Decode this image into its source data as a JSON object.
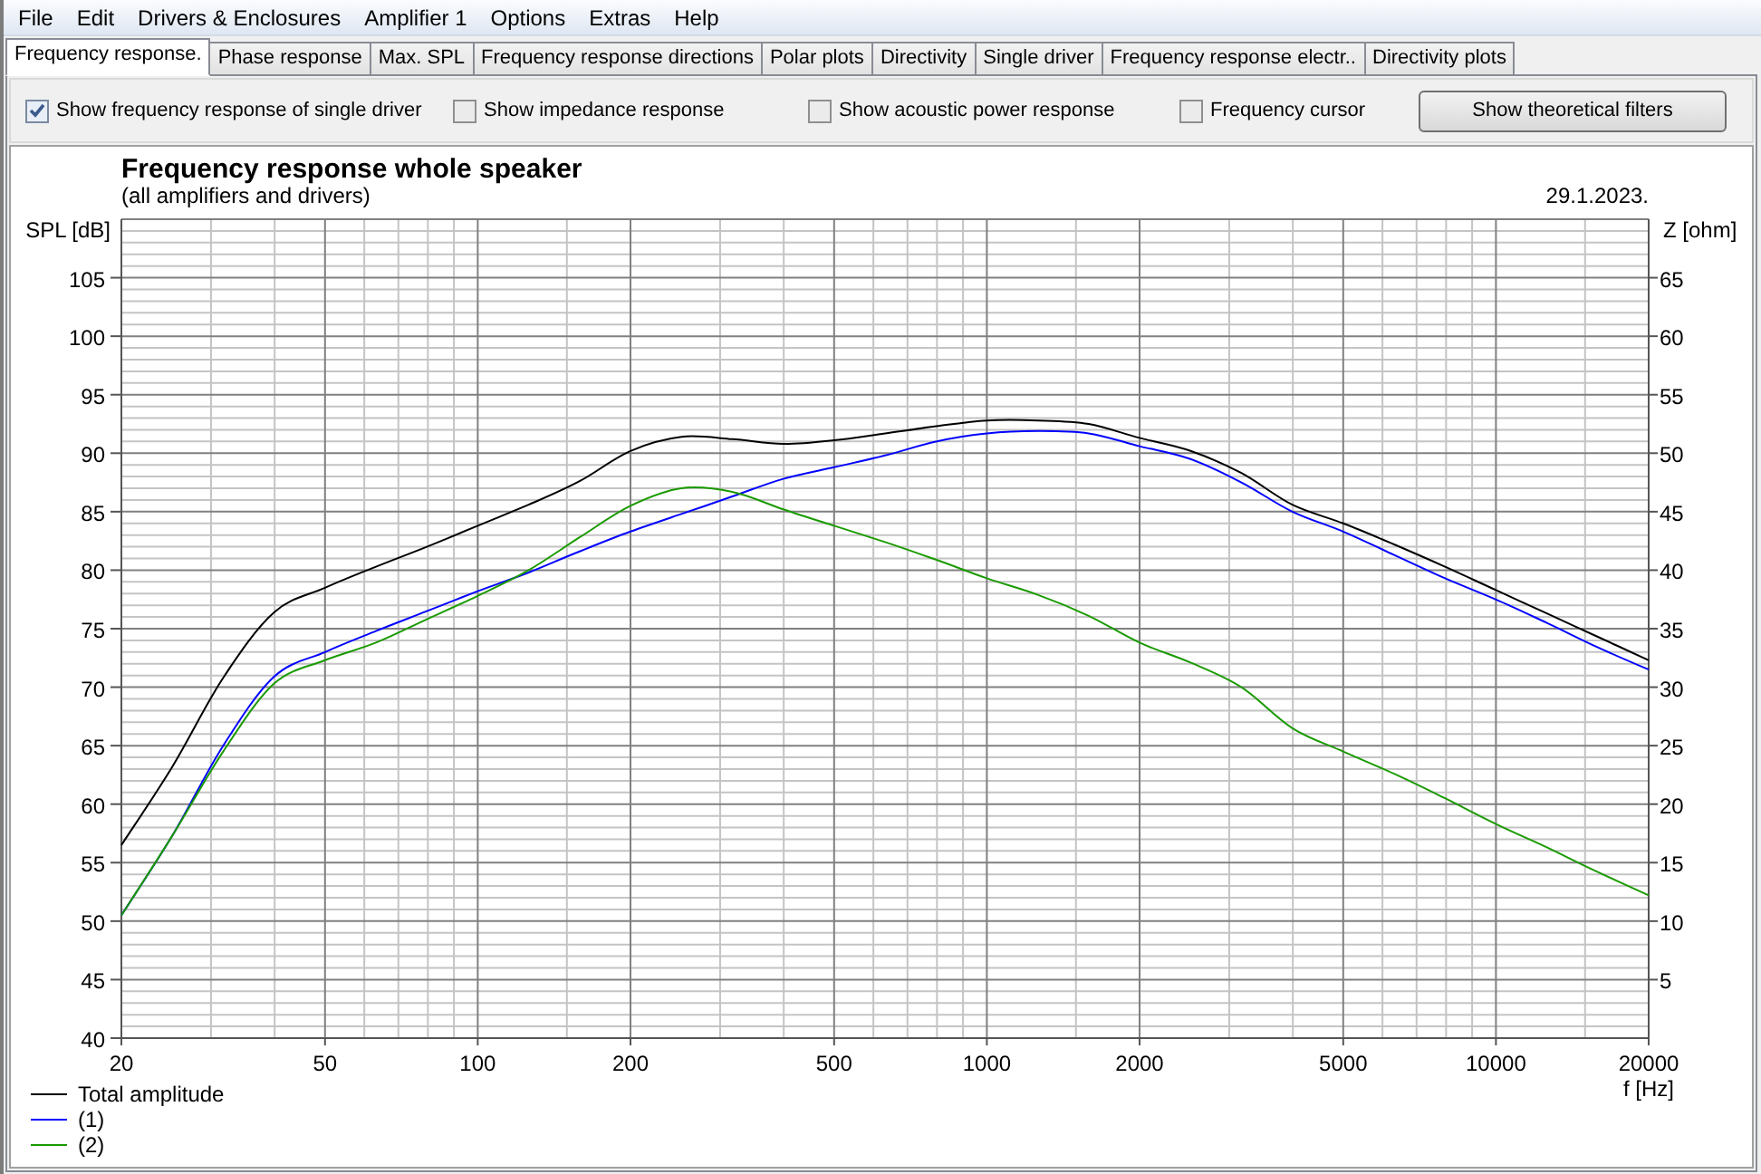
{
  "menu": [
    "File",
    "Edit",
    "Drivers & Enclosures",
    "Amplifier 1",
    "Options",
    "Extras",
    "Help"
  ],
  "tabs": [
    {
      "label": "Frequency response.",
      "selected": true
    },
    {
      "label": "Phase response",
      "selected": false
    },
    {
      "label": "Max. SPL",
      "selected": false
    },
    {
      "label": "Frequency response directions",
      "selected": false
    },
    {
      "label": "Polar plots",
      "selected": false
    },
    {
      "label": "Directivity",
      "selected": false
    },
    {
      "label": "Single driver",
      "selected": false
    },
    {
      "label": "Frequency response electr..",
      "selected": false
    },
    {
      "label": "Directivity plots",
      "selected": false
    }
  ],
  "options": [
    {
      "label": "Show frequency response of single driver",
      "checked": true
    },
    {
      "label": "Show impedance response",
      "checked": false
    },
    {
      "label": "Show acoustic power response",
      "checked": false
    },
    {
      "label": "Frequency cursor",
      "checked": false
    }
  ],
  "filters_button": "Show theoretical filters",
  "chart": {
    "subtitle": "(all amplifiers and drivers)",
    "date": "29.1.2023.",
    "right_axis": {
      "label": "Z [ohm]",
      "ticks": [
        "65",
        "60",
        "55",
        "50",
        "45",
        "40",
        "35",
        "30",
        "25",
        "20",
        "15",
        "10",
        "5"
      ]
    },
    "chart_data": {
      "type": "line",
      "title": "Frequency response whole speaker",
      "xlabel": "f [Hz]",
      "ylabel": "SPL [dB]",
      "ylim": [
        40,
        110
      ],
      "grid": true,
      "legend": "bottom-left",
      "categories": [
        "20",
        null,
        null,
        null,
        "50",
        null,
        null,
        "100",
        null,
        null,
        "200",
        null,
        null,
        null,
        "500",
        null,
        null,
        "1000",
        null,
        null,
        "2000",
        null,
        null,
        null,
        "5000",
        null,
        null,
        "10000",
        null,
        null,
        "20000"
      ],
      "yticks": [
        {
          "value": 40,
          "label": "40"
        },
        {
          "value": 45,
          "label": "45"
        },
        {
          "value": 50,
          "label": "50"
        },
        {
          "value": 55,
          "label": "55"
        },
        {
          "value": 60,
          "label": "60"
        },
        {
          "value": 65,
          "label": "65"
        },
        {
          "value": 70,
          "label": "70"
        },
        {
          "value": 75,
          "label": "75"
        },
        {
          "value": 80,
          "label": "80"
        },
        {
          "value": 85,
          "label": "85"
        },
        {
          "value": 90,
          "label": "90"
        },
        {
          "value": 95,
          "label": "95"
        },
        {
          "value": 100,
          "label": "100"
        },
        {
          "value": 105,
          "label": "105"
        }
      ],
      "series": [
        {
          "name": "Total amplitude",
          "color": "#000000",
          "values": [
            56.5,
            63.2,
            70.8,
            76.4,
            78.5,
            80.3,
            82,
            83.8,
            85.6,
            87.6,
            90.2,
            91.4,
            91.2,
            90.8,
            91.1,
            91.7,
            92.3,
            92.8,
            92.8,
            92.5,
            91.3,
            90.2,
            88.3,
            85.6,
            84,
            82.2,
            80.3,
            78.3,
            76.3,
            74.3,
            72.3
          ]
        },
        {
          "name": "(1)",
          "color": "#0000ff",
          "values": [
            50.5,
            57.3,
            65,
            70.9,
            73,
            74.8,
            76.5,
            78.2,
            79.8,
            81.6,
            83.3,
            84.8,
            86.3,
            87.8,
            88.8,
            89.8,
            91,
            91.7,
            91.9,
            91.7,
            90.6,
            89.5,
            87.5,
            85,
            83.3,
            81.3,
            79.3,
            77.5,
            75.5,
            73.4,
            71.5
          ]
        },
        {
          "name": "(2)",
          "color": "#1a9a00",
          "values": [
            50.5,
            57.3,
            64.5,
            70.3,
            72.3,
            73.8,
            75.8,
            77.8,
            80,
            82.8,
            85.5,
            87,
            86.7,
            85.2,
            83.8,
            82.4,
            80.9,
            79.3,
            77.9,
            76.1,
            73.8,
            72.1,
            70,
            66.5,
            64.5,
            62.6,
            60.5,
            58.3,
            56.3,
            54.2,
            52.2
          ]
        }
      ]
    }
  }
}
